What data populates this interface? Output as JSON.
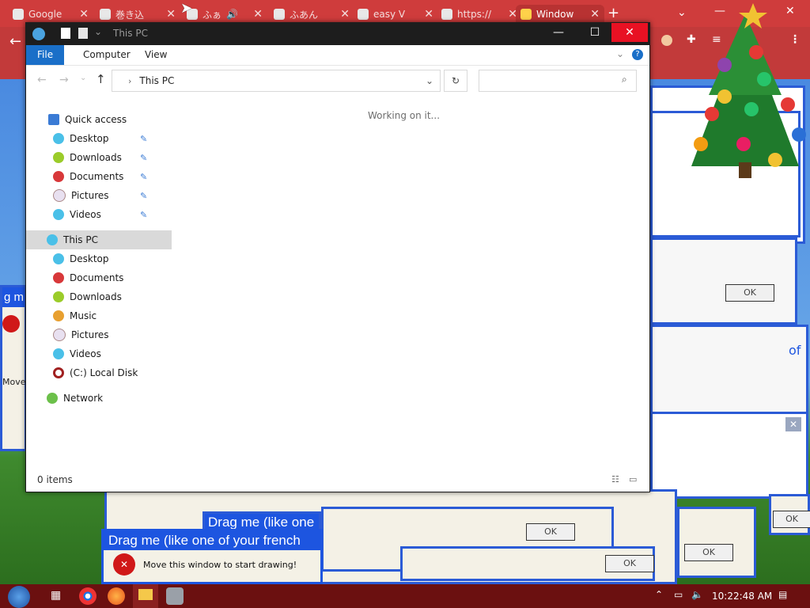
{
  "browser": {
    "tabs": [
      {
        "label": "Google"
      },
      {
        "label": "巻き込"
      },
      {
        "label": "ふぁ"
      },
      {
        "label": "ふあん"
      },
      {
        "label": "easy V"
      },
      {
        "label": "https://"
      },
      {
        "label": "Window"
      }
    ],
    "new_tab": "+"
  },
  "explorer": {
    "title": "This PC",
    "ribbon_tabs": [
      "File",
      "Computer",
      "View"
    ],
    "address": "This PC",
    "search_placeholder": "",
    "loading_text": "Working on it...",
    "status": "0 items",
    "nav": {
      "quick_access": "Quick access",
      "quick_items": [
        "Desktop",
        "Downloads",
        "Documents",
        "Pictures",
        "Videos"
      ],
      "this_pc": "This PC",
      "pc_items": [
        "Desktop",
        "Documents",
        "Downloads",
        "Music",
        "Pictures",
        "Videos",
        "(C:) Local Disk"
      ],
      "network": "Network"
    }
  },
  "popups": {
    "drag_title": "Drag me (like one of your french",
    "drag_title_2": "Drag me (like one",
    "message": "Move this window to start drawing!",
    "ok": "OK",
    "left_fragment_1": "g m",
    "left_fragment_2": "Move",
    "right_fragment": "of"
  },
  "taskbar": {
    "time": "10:22:48 AM"
  },
  "colors": {
    "accent": "#1a6fc8",
    "close_red": "#e81123",
    "browser_red": "#c23a3a",
    "popup_blue": "#1d55e0"
  }
}
